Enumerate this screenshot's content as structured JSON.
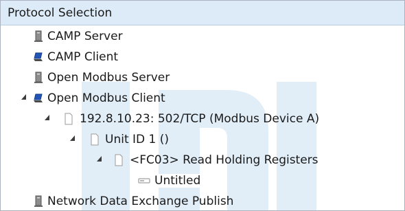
{
  "header": {
    "title": "Protocol Selection"
  },
  "tree": {
    "items": [
      {
        "label": "CAMP Server",
        "icon": "server-tower-icon",
        "level": 1,
        "expandable": false
      },
      {
        "label": "CAMP Client",
        "icon": "client-computer-icon",
        "level": 1,
        "expandable": false
      },
      {
        "label": "Open Modbus Server",
        "icon": "server-tower-icon",
        "level": 1,
        "expandable": false
      },
      {
        "label": "Open Modbus Client",
        "icon": "client-computer-icon",
        "level": 1,
        "expandable": true,
        "expanded": true
      },
      {
        "label": "192.8.10.23: 502/TCP (Modbus Device A)",
        "icon": "document-icon",
        "level": 2,
        "expandable": true,
        "expanded": true
      },
      {
        "label": "Unit ID 1 ()",
        "icon": "document-icon",
        "level": 3,
        "expandable": true,
        "expanded": true
      },
      {
        "label": "<FC03> Read Holding Registers",
        "icon": "document-icon",
        "level": 4,
        "expandable": true,
        "expanded": true
      },
      {
        "label": "Untitled",
        "icon": "register-tag-icon",
        "level": 5,
        "expandable": false,
        "selected": true
      },
      {
        "label": "Network Data Exchange Publish",
        "icon": "server-tower-icon",
        "level": 1,
        "expandable": false
      }
    ]
  },
  "colors": {
    "header_bg": "#dcebf7",
    "watermark": "#e1eef8",
    "border": "#a9b2bd",
    "client_icon": "#2255b8"
  }
}
